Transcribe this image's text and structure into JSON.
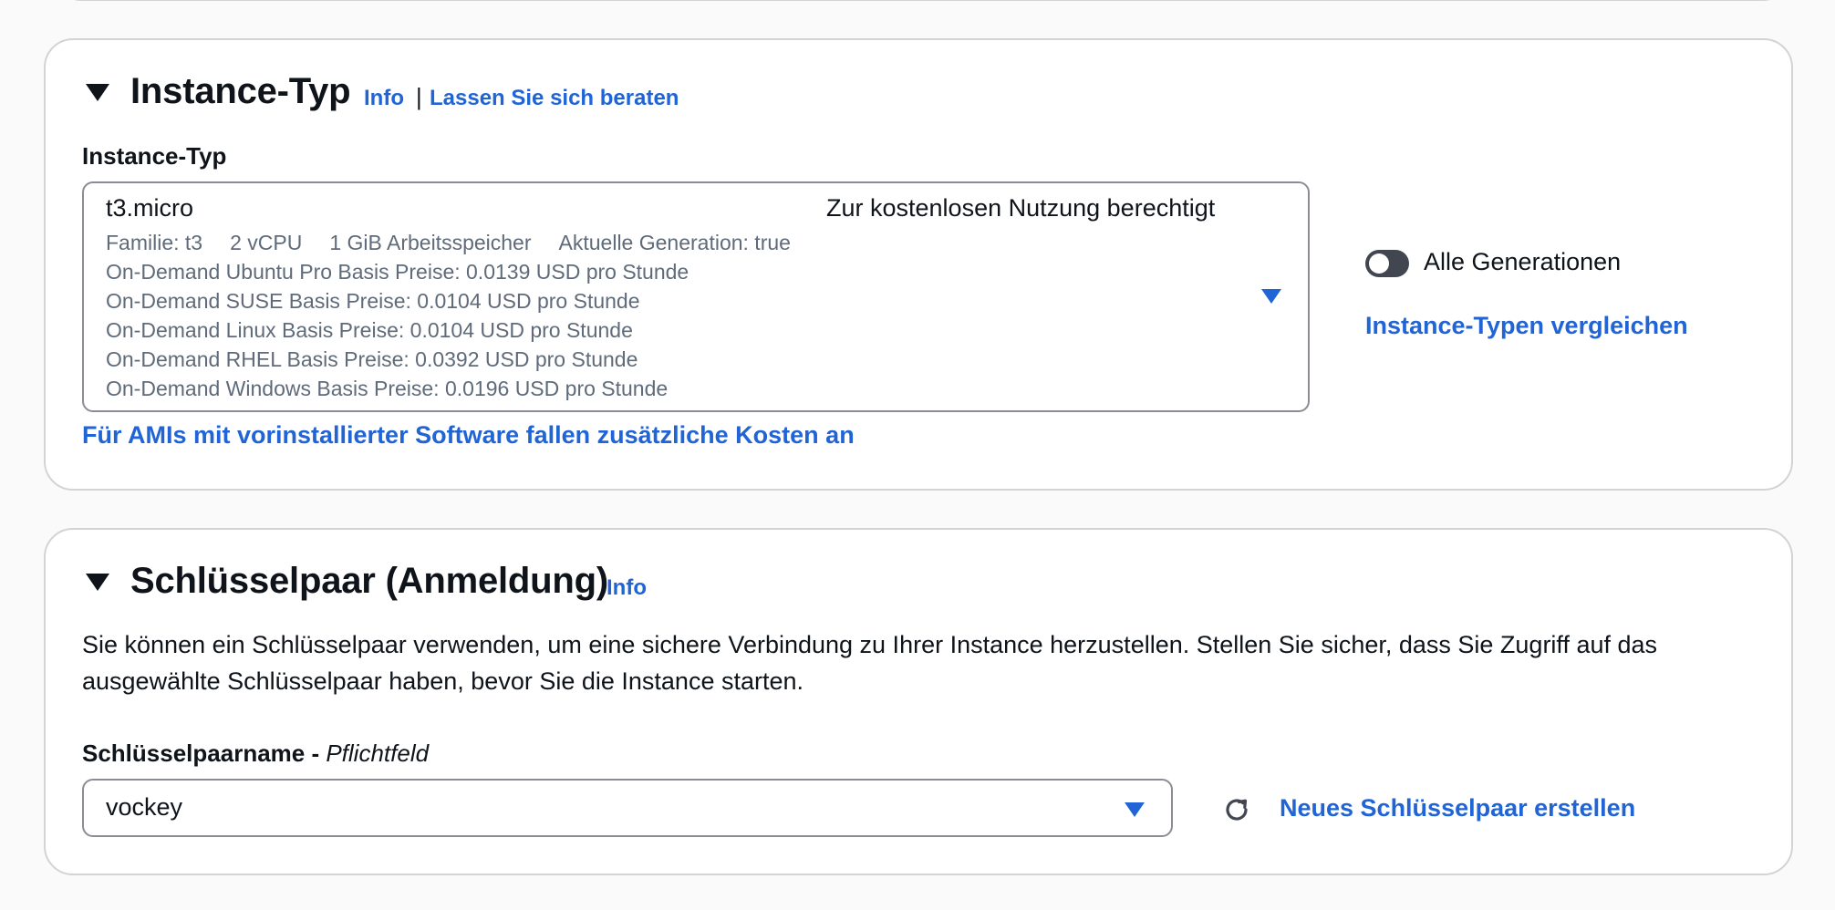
{
  "instance_section": {
    "heading": "Instance-Typ",
    "info_link": "Info",
    "separator": "|",
    "advice_link": "Lassen Sie sich beraten",
    "field_label": "Instance-Typ",
    "selected": {
      "name": "t3.micro",
      "free_tier": "Zur kostenlosen Nutzung berechtigt",
      "specs": [
        "Familie: t3",
        "2 vCPU",
        "1 GiB Arbeitsspeicher",
        "Aktuelle Generation: true"
      ],
      "prices": [
        "On-Demand Ubuntu Pro Basis Preise: 0.0139 USD pro Stunde",
        "On-Demand SUSE Basis Preise: 0.0104 USD pro Stunde",
        "On-Demand Linux Basis Preise: 0.0104 USD pro Stunde",
        "On-Demand RHEL Basis Preise: 0.0392 USD pro Stunde",
        "On-Demand Windows Basis Preise: 0.0196 USD pro Stunde"
      ]
    },
    "toggle_label": "Alle Generationen",
    "compare_link": "Instance-Typen vergleichen",
    "ami_costs_link": "Für AMIs mit vorinstallierter Software fallen zusätzliche Kosten an"
  },
  "keypair_section": {
    "heading": "Schlüsselpaar (Anmeldung)",
    "info_link": "Info",
    "description": "Sie können ein Schlüsselpaar verwenden, um eine sichere Verbindung zu Ihrer Instance herzustellen. Stellen Sie sicher, dass Sie Zugriff auf das ausgewählte Schlüsselpaar haben, bevor Sie die Instance starten.",
    "field_label": "Schlüsselpaarname - ",
    "field_required": "Pflichtfeld",
    "selected_value": "vockey",
    "create_link": "Neues Schlüsselpaar erstellen"
  },
  "colors": {
    "link": "#2064d6",
    "text": "#0f141a",
    "muted": "#5f6b7a",
    "border": "#8c8c94",
    "toggle_off": "#424650"
  },
  "icons": {
    "collapse": "caret-down-icon",
    "select": "dropdown-caret-icon",
    "refresh": "refresh-icon"
  }
}
